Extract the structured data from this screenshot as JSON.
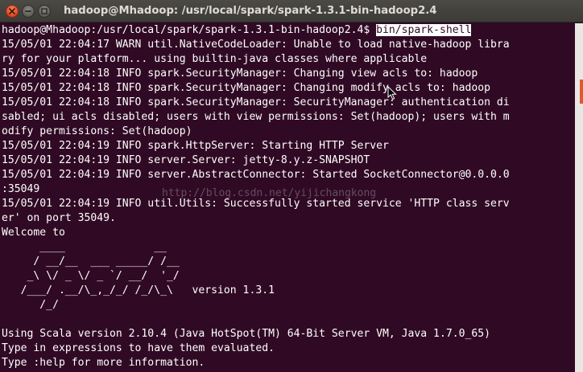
{
  "window": {
    "title": "hadoop@Mhadoop: /usr/local/spark/spark-1.3.1-bin-hadoop2.4",
    "buttons": [
      "close-icon",
      "minimize-icon",
      "maximize-icon"
    ]
  },
  "terminal": {
    "prompt": "hadoop@Mhadoop:/usr/local/spark/spark-1.3.1-bin-hadoop2.4$ ",
    "command": "bin/spark-shell",
    "lines": [
      "15/05/01 22:04:17 WARN util.NativeCodeLoader: Unable to load native-hadoop libra",
      "ry for your platform... using builtin-java classes where applicable",
      "15/05/01 22:04:18 INFO spark.SecurityManager: Changing view acls to: hadoop",
      "15/05/01 22:04:18 INFO spark.SecurityManager: Changing modify acls to: hadoop",
      "15/05/01 22:04:18 INFO spark.SecurityManager: SecurityManager: authentication di",
      "sabled; ui acls disabled; users with view permissions: Set(hadoop); users with m",
      "odify permissions: Set(hadoop)",
      "15/05/01 22:04:19 INFO spark.HttpServer: Starting HTTP Server",
      "15/05/01 22:04:19 INFO server.Server: jetty-8.y.z-SNAPSHOT",
      "15/05/01 22:04:19 INFO server.AbstractConnector: Started SocketConnector@0.0.0.0",
      ":35049",
      "15/05/01 22:04:19 INFO util.Utils: Successfully started service 'HTTP class serv",
      "er' on port 35049.",
      "Welcome to",
      "      ____              __",
      "     / __/__  ___ _____/ /__",
      "    _\\ \\/ _ \\/ _ `/ __/  '_/",
      "   /___/ .__/\\_,_/_/ /_/\\_\\   version 1.3.1",
      "      /_/",
      "",
      "Using Scala version 2.10.4 (Java HotSpot(TM) 64-Bit Server VM, Java 1.7.0_65)",
      "Type in expressions to have them evaluated.",
      "Type :help for more information."
    ]
  },
  "watermark": "http://blog.csdn.net/yijichangkong",
  "colors": {
    "terminal_bg": "#300a24",
    "terminal_fg": "#ffffff",
    "titlebar_bg": "#3c3b37",
    "close_button": "#e0461c",
    "scroll_accent": "#e2572e"
  }
}
